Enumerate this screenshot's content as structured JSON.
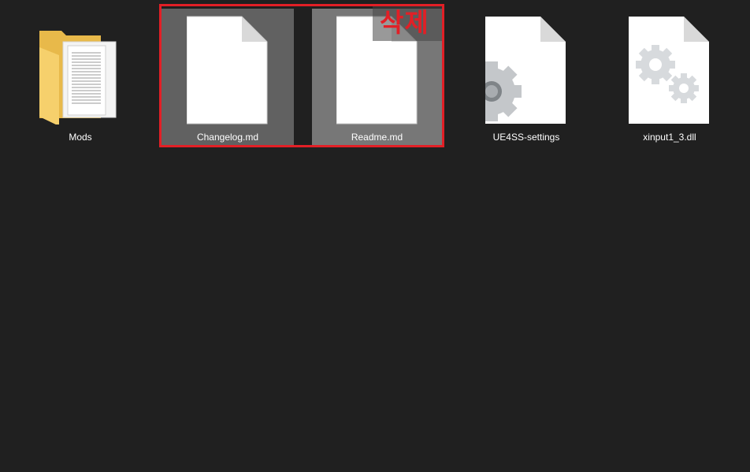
{
  "files": [
    {
      "name": "Mods",
      "icon": "folder-icon",
      "selected": false
    },
    {
      "name": "Changelog.md",
      "icon": "document-icon",
      "selected": true
    },
    {
      "name": "Readme.md",
      "icon": "document-icon",
      "selected": true
    },
    {
      "name": "UE4SS-settings",
      "icon": "settings-file-icon",
      "selected": false
    },
    {
      "name": "xinput1_3.dll",
      "icon": "dll-file-icon",
      "selected": false
    }
  ],
  "annotation": {
    "label": "삭제",
    "color": "#e21f26"
  },
  "colors": {
    "background": "#202020",
    "selection": "#616161"
  }
}
